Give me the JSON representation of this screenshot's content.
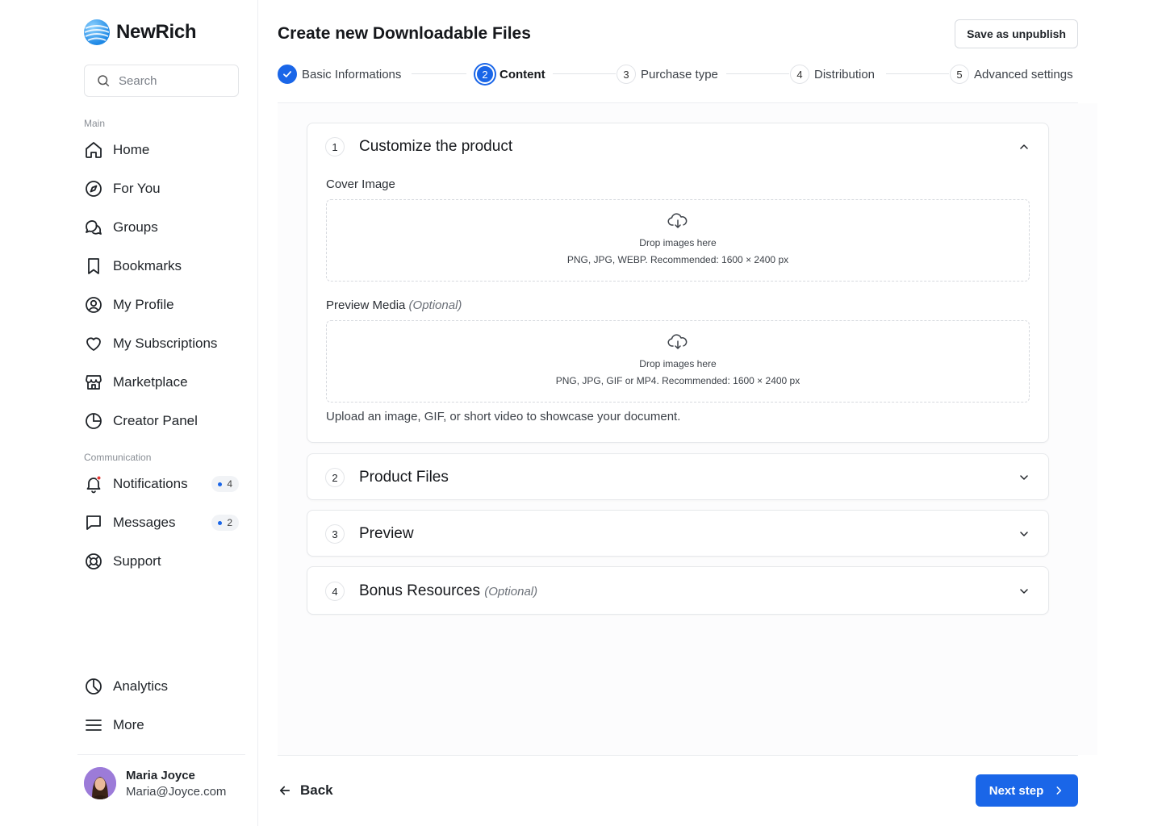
{
  "brand": {
    "name": "NewRich"
  },
  "search": {
    "placeholder": "Search"
  },
  "sidebar": {
    "section_main": "Main",
    "main_items": [
      {
        "label": "Home",
        "icon": "home-icon"
      },
      {
        "label": "For You",
        "icon": "compass-icon"
      },
      {
        "label": "Groups",
        "icon": "chat-bubbles-icon"
      },
      {
        "label": "Bookmarks",
        "icon": "bookmark-icon"
      },
      {
        "label": "My Profile",
        "icon": "user-circle-icon"
      },
      {
        "label": "My Subscriptions",
        "icon": "heart-icon"
      },
      {
        "label": "Marketplace",
        "icon": "store-icon"
      },
      {
        "label": "Creator Panel",
        "icon": "pie-chart-icon"
      }
    ],
    "section_communication": "Communication",
    "comm_items": [
      {
        "label": "Notifications",
        "icon": "bell-icon",
        "badge": "4"
      },
      {
        "label": "Messages",
        "icon": "message-icon",
        "badge": "2"
      },
      {
        "label": "Support",
        "icon": "lifebuoy-icon"
      }
    ],
    "bottom_items": [
      {
        "label": "Analytics",
        "icon": "analytics-icon"
      },
      {
        "label": "More",
        "icon": "menu-icon"
      }
    ]
  },
  "user": {
    "name": "Maria Joyce",
    "email": "Maria@Joyce.com"
  },
  "header": {
    "title": "Create new Downloadable Files",
    "save_label": "Save as unpublish"
  },
  "stepper": [
    {
      "number": "1",
      "label": "Basic Informations",
      "state": "done"
    },
    {
      "number": "2",
      "label": "Content",
      "state": "active"
    },
    {
      "number": "3",
      "label": "Purchase type",
      "state": "pending"
    },
    {
      "number": "4",
      "label": "Distribution",
      "state": "pending"
    },
    {
      "number": "5",
      "label": "Advanced settings",
      "state": "pending"
    }
  ],
  "sections": [
    {
      "number": "1",
      "title": "Customize the product",
      "expanded": true,
      "cover": {
        "label": "Cover Image",
        "drop_title": "Drop images here",
        "drop_sub": "PNG, JPG, WEBP. Recommended: 1600 × 2400 px"
      },
      "preview": {
        "label": "Preview Media",
        "optional": "(Optional)",
        "drop_title": "Drop images here",
        "drop_sub": "PNG, JPG, GIF or MP4. Recommended: 1600 × 2400 px"
      },
      "hint": "Upload an image, GIF, or short video to showcase your document."
    },
    {
      "number": "2",
      "title": "Product Files",
      "expanded": false
    },
    {
      "number": "3",
      "title": "Preview",
      "expanded": false
    },
    {
      "number": "4",
      "title": "Bonus Resources",
      "optional": "(Optional)",
      "expanded": false
    }
  ],
  "footer": {
    "back_label": "Back",
    "next_label": "Next step"
  },
  "colors": {
    "accent": "#1a66e8",
    "notification_dot": "#e53935"
  }
}
